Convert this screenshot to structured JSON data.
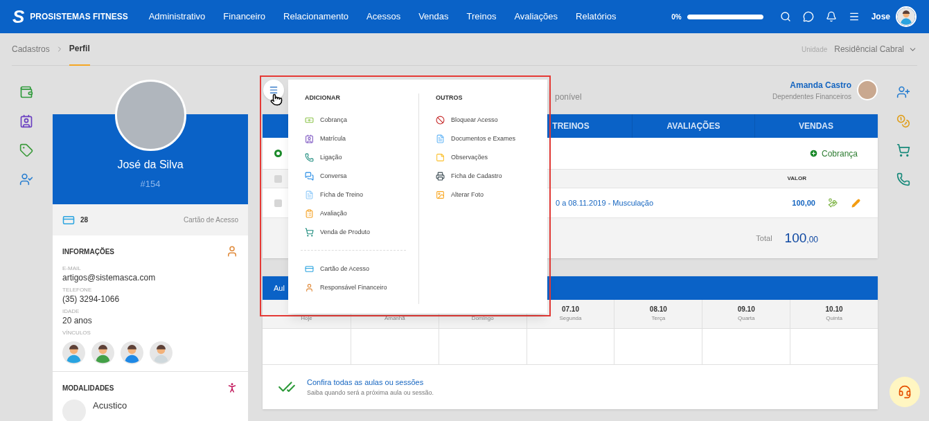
{
  "header": {
    "logo_mark": "S",
    "brand": "PROSISTEMAS FITNESS",
    "nav": [
      "Administrativo",
      "Financeiro",
      "Relacionamento",
      "Acessos",
      "Vendas",
      "Treinos",
      "Avaliações",
      "Relatórios"
    ],
    "progress_label": "0%",
    "progress": {
      "level": 1
    },
    "user": "Jose"
  },
  "breadcrumb": {
    "items": [
      {
        "label": "Cadastros",
        "selected": false
      },
      {
        "label": "Perfil",
        "selected": true
      }
    ],
    "unit_label": "Unidade",
    "unit_value": "Residêncial Cabral"
  },
  "profile": {
    "name": "José da Silva",
    "id": "#154",
    "card_count": "28",
    "card_label": "Cartão de Acesso",
    "info_title": "INFORMAÇÕES",
    "fields": [
      {
        "label": "E-MAIL",
        "value": "artigos@sistemasca.com"
      },
      {
        "label": "TELEFONE",
        "value": "(35) 3294-1066"
      },
      {
        "label": "IDADE",
        "value": "20 anos"
      }
    ],
    "links_label": "VÍNCULOS",
    "links": [
      {
        "color": "#29a3e0"
      },
      {
        "color": "#43a047"
      },
      {
        "color": "#1e88e5"
      },
      {
        "color": "#cfd8dc"
      }
    ],
    "modalities_title": "MODALIDADES",
    "modalities": [
      "Acustico"
    ]
  },
  "menu": {
    "sections": [
      {
        "title": "ADICIONAR",
        "groups": [
          [
            "Cobrança",
            "Matrícula",
            "Ligação",
            "Conversa",
            "Ficha de Treino",
            "Avaliação",
            "Venda de Produto"
          ],
          [
            "Cartão de Acesso",
            "Responsável Financeiro"
          ]
        ]
      },
      {
        "title": "OUTROS",
        "groups": [
          [
            "Bloquear Acesso",
            "Documentos e Exames",
            "Observações",
            "Ficha de Cadastro",
            "Alterar Foto"
          ]
        ]
      }
    ]
  },
  "main": {
    "status_fragment": "ponível",
    "dependent": {
      "name": "Amanda Castro",
      "role": "Dependentes Financeiros"
    },
    "tabs": [
      {
        "label": "TREINOS",
        "selected": false
      },
      {
        "label": "AVALIAÇÕES",
        "selected": false
      },
      {
        "label": "VENDAS",
        "selected": false
      }
    ],
    "filter": {
      "selected": true
    },
    "add_button": "Cobrança",
    "table": {
      "columns": [
        "VALOR"
      ],
      "header_checked": false,
      "rows": [
        {
          "description": "0 a 08.11.2019 - Musculação",
          "value": "100,00",
          "checked": false
        }
      ],
      "total_label": "Total",
      "total_int": "100",
      "total_dec": ",00"
    },
    "schedule": {
      "title_fragment": "Aul",
      "days": [
        {
          "weekday": "Hoje"
        },
        {
          "weekday": "Amanhã"
        },
        {
          "weekday": "Domingo"
        },
        {
          "date": "07.10",
          "weekday": "Segunda"
        },
        {
          "date": "08.10",
          "weekday": "Terça"
        },
        {
          "date": "09.10",
          "weekday": "Quarta"
        },
        {
          "date": "10.10",
          "weekday": "Quinta"
        }
      ]
    },
    "footer": {
      "title": "Confira todas as aulas ou sessões",
      "subtitle": "Saiba quando será a próxima aula ou sessão."
    }
  }
}
